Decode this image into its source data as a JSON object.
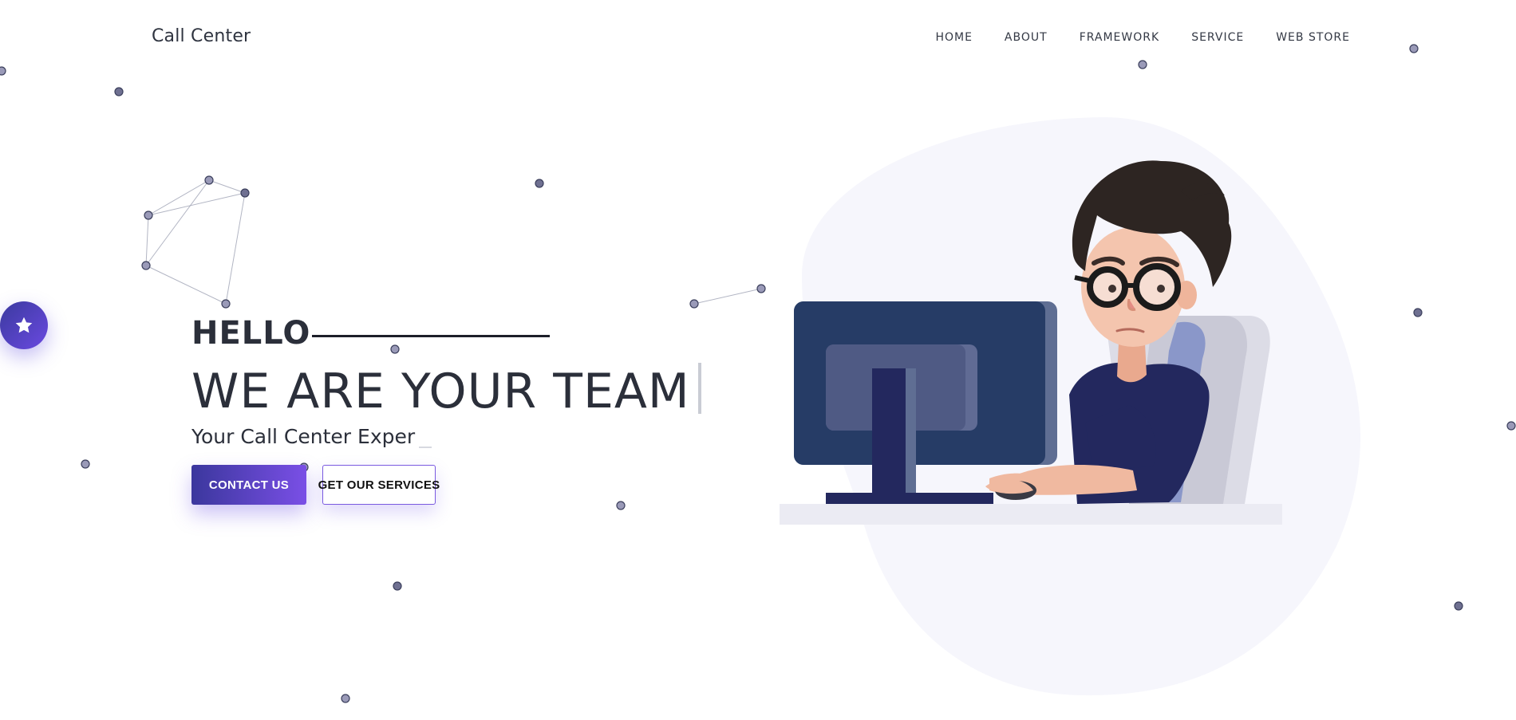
{
  "brand": {
    "name": "Call Center"
  },
  "nav": {
    "items": [
      "HOME",
      "ABOUT",
      "FRAMEWORK",
      "SERVICE",
      "WEB STORE"
    ]
  },
  "hero": {
    "hello": "HELLO",
    "headline": "WE ARE YOUR TEAM",
    "subtitle": "Your Call Center Exper",
    "contact_button": "CONTACT US",
    "services_button": "GET OUR SERVICES"
  },
  "icons": {
    "float_button": "star-icon",
    "illustration": "call-center-agent-illustration"
  },
  "colors": {
    "accent_start": "#3b379d",
    "accent_end": "#7a4fe6",
    "text": "#2b2f3a"
  }
}
